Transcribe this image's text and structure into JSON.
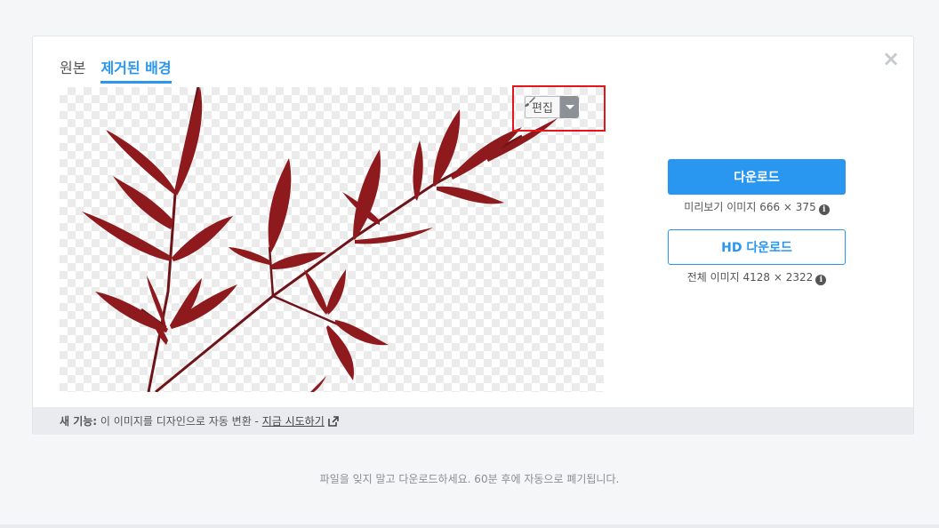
{
  "tabs": [
    {
      "label": "원본",
      "active": false
    },
    {
      "label": "제거된 배경",
      "active": true
    }
  ],
  "close_label": "×",
  "editor": {
    "edit_label": "편집"
  },
  "download": {
    "label": "다운로드",
    "size_text": "미리보기 이미지 666 × 375"
  },
  "hd_download": {
    "label": "HD 다운로드",
    "size_text": "전체 이미지 4128 × 2322"
  },
  "info_glyph": "i",
  "footer": {
    "new_label": "새 기능:",
    "text": " 이 이미지를 디자인으로 자동 변환 - ",
    "link": "지금 시도하기"
  },
  "bottom_note": "파일을 잊지 말고 다운로드하세요. 60분 후에 자동으로 폐기됩니다.",
  "colors": {
    "accent": "#2996f0",
    "highlight": "#e8141b",
    "leaf": "#8e1a1e"
  }
}
